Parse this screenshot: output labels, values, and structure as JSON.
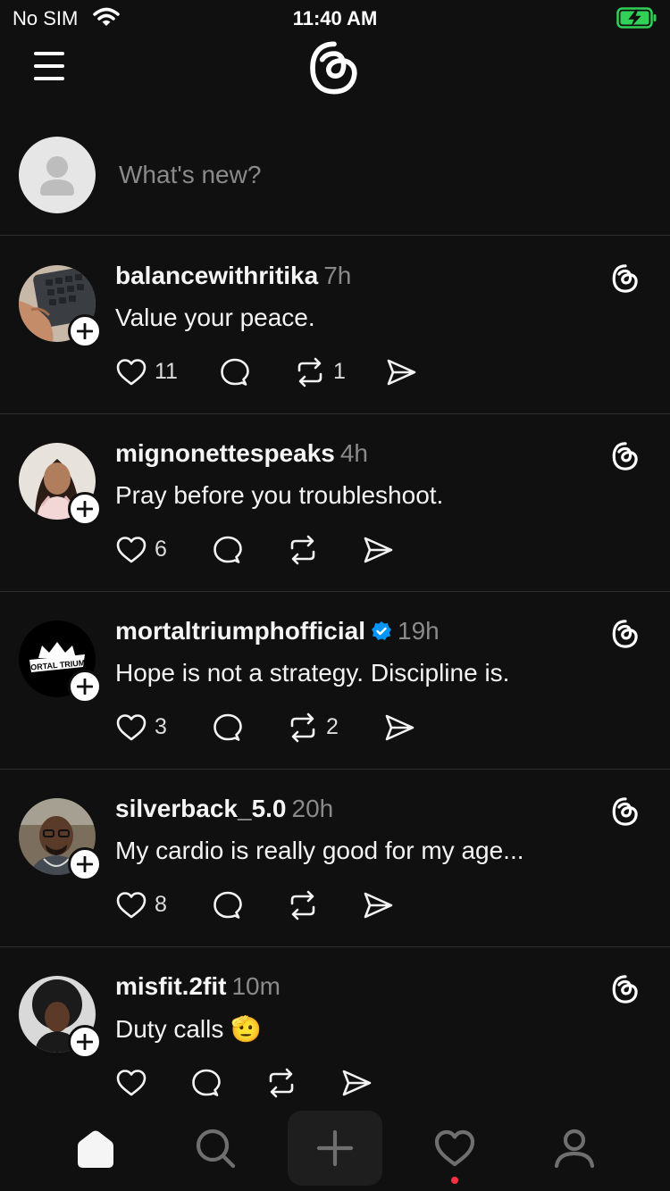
{
  "status_bar": {
    "carrier": "No SIM",
    "time": "11:40 AM",
    "battery_color": "#31d158"
  },
  "header": {
    "menu_icon": "hamburger-icon",
    "logo_icon": "threads-logo-icon"
  },
  "composer": {
    "placeholder": "What's new?"
  },
  "posts": [
    {
      "username": "balancewithritika",
      "verified": false,
      "time": "7h",
      "text": "Value your peace.",
      "likes": "11",
      "replies": "",
      "reposts": "1"
    },
    {
      "username": "mignonettespeaks",
      "verified": false,
      "time": "4h",
      "text": "Pray before you troubleshoot.",
      "likes": "6",
      "replies": "",
      "reposts": ""
    },
    {
      "username": "mortaltriumphofficial",
      "verified": true,
      "time": "19h",
      "text": "Hope is not a strategy. Discipline is.",
      "likes": "3",
      "replies": "",
      "reposts": "2",
      "avatar_text": "MORTAL TRIUMP"
    },
    {
      "username": "silverback_5.0",
      "verified": false,
      "time": "20h",
      "text": "My cardio is really good for my age...",
      "likes": "8",
      "replies": "",
      "reposts": ""
    },
    {
      "username": "misfit.2fit",
      "verified": false,
      "time": "10m",
      "text": "Duty calls 🫡",
      "likes": "",
      "replies": "",
      "reposts": ""
    }
  ],
  "tab_bar": {
    "tabs": [
      {
        "name": "home",
        "icon": "home-icon",
        "active": true
      },
      {
        "name": "search",
        "icon": "search-icon",
        "active": false
      },
      {
        "name": "create",
        "icon": "plus-icon",
        "active": false
      },
      {
        "name": "activity",
        "icon": "heart-icon",
        "active": false,
        "badge_color": "#ff3040"
      },
      {
        "name": "profile",
        "icon": "person-icon",
        "active": false
      }
    ]
  },
  "colors": {
    "background": "#101010",
    "divider": "#2e2e2e",
    "muted": "#8a8a8a",
    "verified": "#0095f6"
  }
}
